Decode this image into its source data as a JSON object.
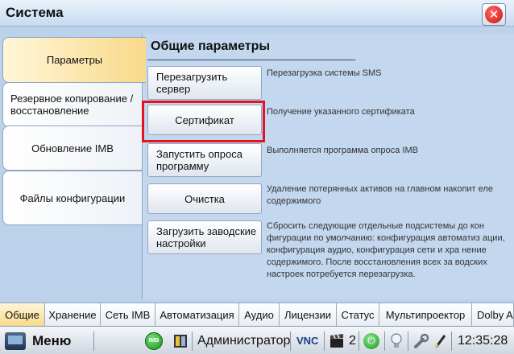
{
  "window": {
    "title": "Система"
  },
  "sidebar": {
    "tabs": [
      {
        "label": "Параметры"
      },
      {
        "label": "Резервное копирование / восстановление"
      },
      {
        "label": "Обновление IMB"
      },
      {
        "label": "Файлы конфигурации"
      }
    ]
  },
  "panel": {
    "title": "Общие параметры",
    "actions": [
      {
        "button": "Перезагрузить сервер",
        "description": "Перезагрузка системы SMS"
      },
      {
        "button": "Сертификат",
        "description": "Получение указанного сертификата"
      },
      {
        "button": "Запустить опроса программу",
        "description": "Выполняется программа опроса IMB"
      },
      {
        "button": "Очистка",
        "description": "Удаление потерянных активов на главном накопит еле содержимого"
      },
      {
        "button": "Загрузить заводские настройки",
        "description": "Сбросить следующие отдельные подсистемы до кон фигурации по умолчанию: конфигурация автоматиз ации, конфигурация аудио, конфигурация сети и хра нение содержимого. После восстановления всех за водских настроек потребуется перезагрузка."
      }
    ]
  },
  "bottom_tabs": [
    {
      "label": "Общие"
    },
    {
      "label": "Хранение"
    },
    {
      "label": "Сеть IMB"
    },
    {
      "label": "Автоматизация"
    },
    {
      "label": "Аудио"
    },
    {
      "label": "Лицензии"
    },
    {
      "label": "Статус"
    },
    {
      "label": "Мультипроектор"
    },
    {
      "label": "Dolby At"
    }
  ],
  "taskbar": {
    "menu_label": "Меню",
    "imb_badge": "IMB",
    "user": "Администратор",
    "vnc": "VNC",
    "count": "2",
    "time": "12:35:28"
  },
  "colors": {
    "highlight": "#e3141f",
    "active_tab": "#f8d989"
  },
  "icons": [
    "close-icon",
    "menu-icon",
    "imb-icon",
    "media-icon",
    "vnc-icon",
    "clapper-icon",
    "power-icon",
    "bulb-icon",
    "wrench-icon",
    "pen-icon"
  ]
}
